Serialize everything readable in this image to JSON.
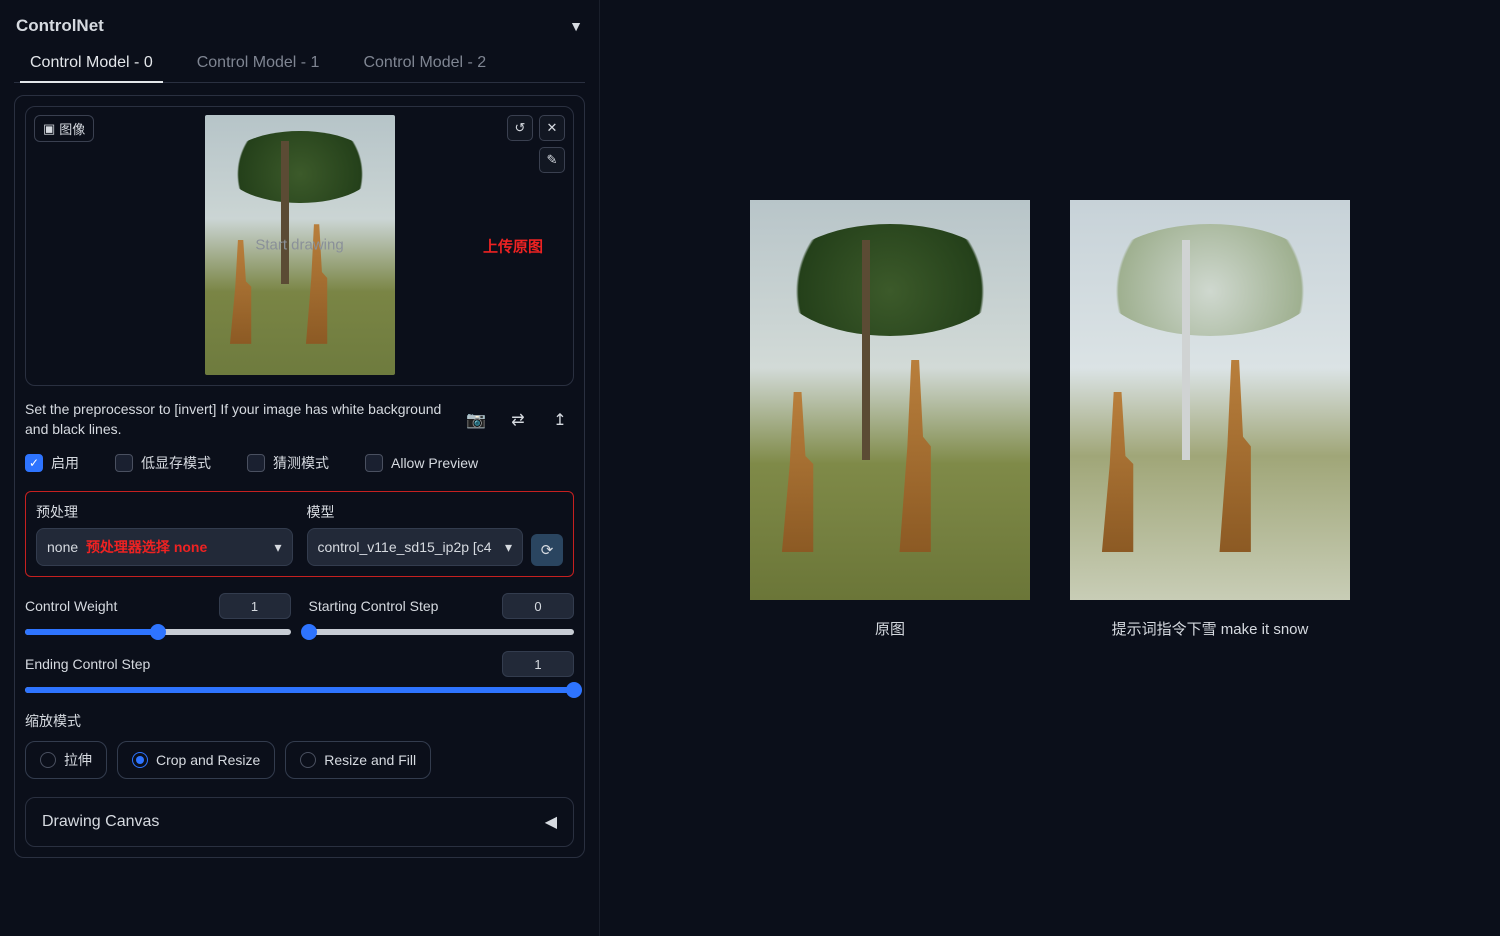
{
  "header": {
    "title": "ControlNet"
  },
  "tabs": [
    "Control Model - 0",
    "Control Model - 1",
    "Control Model - 2"
  ],
  "image": {
    "tag": "图像",
    "watermark": "Start drawing",
    "annotation": "上传原图",
    "icons": {
      "undo": "↺",
      "close": "✕",
      "edit": "✎"
    }
  },
  "help_text": "Set the preprocessor to [invert] If your image has white background and black lines.",
  "toolbar_icons": {
    "camera": "📷",
    "swap": "⇄",
    "upload": "↥"
  },
  "checks": {
    "enable": "启用",
    "lowvram": "低显存模式",
    "guess": "猜测模式",
    "preview": "Allow Preview"
  },
  "preproc": {
    "label": "预处理",
    "value": "none",
    "annotation": "预处理器选择 none"
  },
  "model": {
    "label": "模型",
    "value": "control_v11e_sd15_ip2p [c4"
  },
  "sliders": {
    "weight": {
      "label": "Control Weight",
      "value": "1",
      "pct": 50
    },
    "start": {
      "label": "Starting Control Step",
      "value": "0",
      "pct": 0
    },
    "end": {
      "label": "Ending Control Step",
      "value": "1",
      "pct": 100
    }
  },
  "resize": {
    "label": "缩放模式",
    "options": [
      "拉伸",
      "Crop and Resize",
      "Resize and Fill"
    ],
    "selected": 1
  },
  "accordion": {
    "label": "Drawing Canvas"
  },
  "gallery": {
    "left_caption": "原图",
    "right_caption": "提示词指令下雪 make it snow"
  }
}
